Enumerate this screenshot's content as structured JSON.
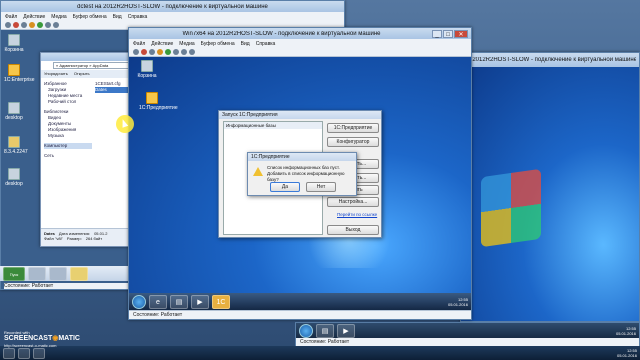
{
  "dctest": {
    "title": "dctest на 2012R2HOST-SLOW - подключение к виртуальной машине",
    "menu": [
      "Файл",
      "Действие",
      "Медиа",
      "Буфер обмена",
      "Вид",
      "Справка"
    ],
    "status": "Состояние: Работает"
  },
  "host_icons": [
    "Корзина",
    "1С:Enterprise",
    "desktop",
    "8.3.4.2247",
    "desktop"
  ],
  "explorer": {
    "address": "« Администратор » AppData",
    "organize": "Упорядочить",
    "open": "Открыть",
    "favorites": "Избранное",
    "downloads": "Загрузки",
    "recent": "Недавние места",
    "desktop": "Рабочий стол",
    "libraries": "Библиотеки",
    "video": "Видео",
    "docs": "Документы",
    "images": "Изображения",
    "music": "Музыка",
    "computer": "Компьютер",
    "network": "Сеть",
    "file1": "1CEStart.cfg",
    "file2": "8.3.4.2247",
    "sel_name": "Dates",
    "sel_kind": "Файл \"v8i\"",
    "sel_date_label": "Дата изменения:",
    "sel_date": "05.01.2",
    "sel_size_label": "Размер:",
    "sel_size": "264 байт"
  },
  "dctask": {
    "start": "Пуск",
    "status": "Состояние: Работает"
  },
  "win7": {
    "title": "Win7x64 на 2012R2HOST-SLOW - подключение к виртуальной машине",
    "menu": [
      "Файл",
      "Действие",
      "Медиа",
      "Буфер обмена",
      "Вид",
      "Справка"
    ],
    "icon_recycle": "Корзина",
    "icon_1c": "1С:Предприятие",
    "status": "Состояние: Работает",
    "clock_time": "12:55",
    "clock_date": "05.01.2016"
  },
  "launcher": {
    "title": "Запуск 1С:Предприятия",
    "list_header": "Информационные базы",
    "btn_run": "1С:Предприятие",
    "btn_config": "Конфигуратор",
    "btn_add": "Добавить...",
    "btn_edit": "Изменить...",
    "btn_delete": "Удалить",
    "btn_settings": "Настройка...",
    "btn_exit": "Выход",
    "link": "Перейти по ссылке"
  },
  "prompt": {
    "title": "1С:Предприятие",
    "line1": "Список информационных баз пуст.",
    "line2": "Добавить в список информационную базу?",
    "yes": "Да",
    "no": "Нет"
  },
  "vm3": {
    "title": "на 2012R2HOST-SLOW - подключение к виртуальной машине",
    "status": "Состояние: Работает",
    "clock_time": "12:55",
    "clock_date": "05.01.2016"
  },
  "screencast": {
    "line1": "Recorded with",
    "line2": "SCREENCAST",
    "line3": "MATIC",
    "line4": "http://screencast-o-matic.com"
  },
  "host_clock": {
    "time": "12:55",
    "date": "05.01.2016"
  }
}
